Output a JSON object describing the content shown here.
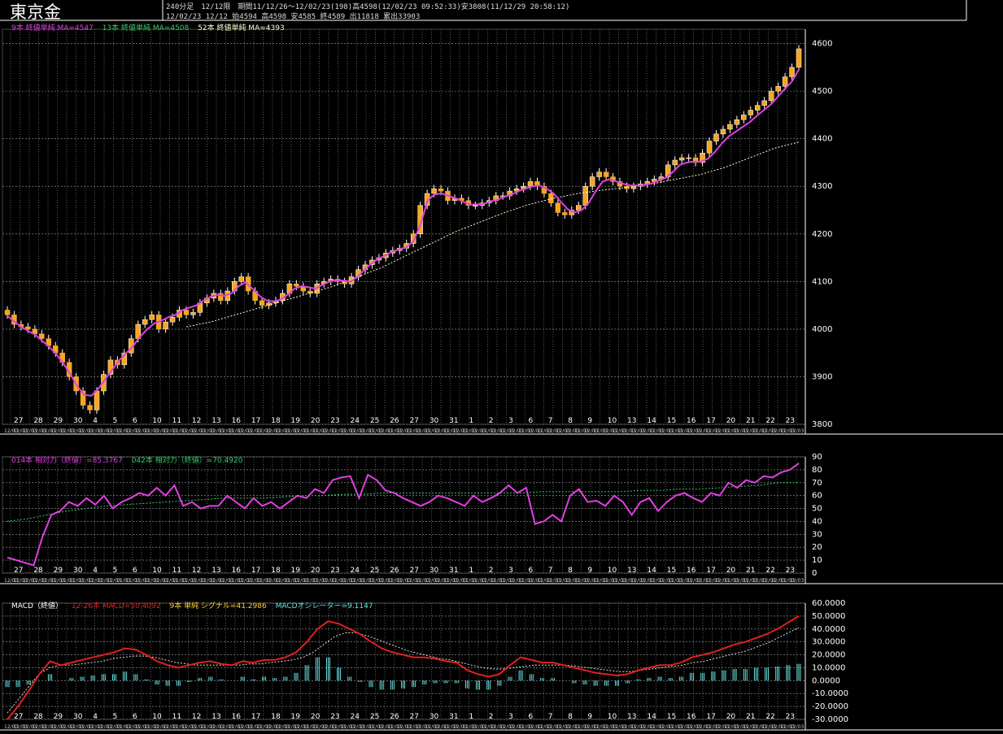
{
  "header": {
    "symbol": "東京金",
    "info_line1": "240分足　12/12限　期間11/12/26〜12/02/23(198)高4598(12/02/23 09:52:33)安3808(11/12/29 20:58:12)",
    "info_line2": "12/02/23 12/12 始4594 高4598 安4585 終4589 出11818 累出33903"
  },
  "colors": {
    "background": "#000000",
    "grid": "#c8c8c8",
    "candle_up": "#ffffff",
    "candle_down": "#f5a623",
    "ma9": "#e040e0",
    "ma13": "#33cc66",
    "ma52": "#ffffcc",
    "rsi14": "#e040e0",
    "rsi42": "#33cc66",
    "macd": "#e02020",
    "signal": "#dddddd",
    "oscillator": "#66e0e0",
    "axis_text": "#ffffff"
  },
  "x_date_labels": [
    "27",
    "28",
    "29",
    "30",
    "4",
    "5",
    "6",
    "10",
    "11",
    "12",
    "13",
    "16",
    "17",
    "18",
    "19",
    "20",
    "23",
    "24",
    "25",
    "26",
    "27",
    "30",
    "31",
    "1",
    "2",
    "3",
    "6",
    "7",
    "8",
    "9",
    "10",
    "13",
    "14",
    "15",
    "16",
    "17",
    "20",
    "21",
    "22",
    "23"
  ],
  "x_month_labels": [
    "1",
    "1",
    "2"
  ],
  "chart_data": [
    {
      "type": "candlestick",
      "name": "price",
      "legend": [
        "9本 終値単純 MA=4547",
        "13本 終値単純 MA=4508",
        "52本 終値単純 MA=4393"
      ],
      "yticks": [
        3800,
        3900,
        4000,
        4100,
        4200,
        4300,
        4400,
        4500,
        4600
      ],
      "ylim": [
        3800,
        4630
      ],
      "x_dates": [
        "11/12/27",
        "11/12/28",
        "11/12/29",
        "11/12/30",
        "12/01/04",
        "12/01/05",
        "12/01/06",
        "12/01/10",
        "12/01/11",
        "12/01/12",
        "12/01/13",
        "12/01/16",
        "12/01/17",
        "12/01/18",
        "12/01/19",
        "12/01/20",
        "12/01/23",
        "12/01/24",
        "12/01/25",
        "12/01/26",
        "12/01/27",
        "12/01/30",
        "12/01/31",
        "12/02/01",
        "12/02/02",
        "12/02/03",
        "12/02/06",
        "12/02/07",
        "12/02/08",
        "12/02/09",
        "12/02/10",
        "12/02/13",
        "12/02/14",
        "12/02/15",
        "12/02/16",
        "12/02/17",
        "12/02/20",
        "12/02/21",
        "12/02/22",
        "12/02/23"
      ],
      "closes": [
        4030,
        4010,
        4005,
        4000,
        3990,
        3980,
        3965,
        3950,
        3930,
        3900,
        3870,
        3840,
        3830,
        3870,
        3905,
        3935,
        3925,
        3950,
        3980,
        4010,
        4020,
        4030,
        4000,
        4015,
        4025,
        4040,
        4030,
        4035,
        4055,
        4065,
        4075,
        4060,
        4080,
        4100,
        4110,
        4080,
        4060,
        4050,
        4055,
        4060,
        4075,
        4095,
        4090,
        4080,
        4075,
        4095,
        4100,
        4105,
        4100,
        4095,
        4110,
        4125,
        4135,
        4145,
        4150,
        4160,
        4165,
        4170,
        4180,
        4200,
        4260,
        4285,
        4295,
        4290,
        4270,
        4275,
        4270,
        4260,
        4260,
        4265,
        4270,
        4280,
        4280,
        4290,
        4295,
        4300,
        4310,
        4300,
        4285,
        4265,
        4245,
        4240,
        4250,
        4260,
        4300,
        4320,
        4330,
        4320,
        4310,
        4300,
        4295,
        4300,
        4305,
        4310,
        4315,
        4320,
        4345,
        4355,
        4360,
        4360,
        4350,
        4370,
        4395,
        4410,
        4420,
        4430,
        4440,
        4450,
        4460,
        4470,
        4480,
        4500,
        4510,
        4530,
        4550,
        4589
      ],
      "ma9": [
        4028,
        4016,
        4005,
        3996,
        3988,
        3975,
        3962,
        3947,
        3928,
        3905,
        3880,
        3862,
        3860,
        3875,
        3895,
        3915,
        3935,
        3950,
        3965,
        3985,
        4000,
        4012,
        4018,
        4025,
        4030,
        4040,
        4045,
        4050,
        4060,
        4068,
        4072,
        4070,
        4075,
        4090,
        4098,
        4085,
        4070,
        4060,
        4058,
        4062,
        4072,
        4085,
        4090,
        4088,
        4085,
        4093,
        4100,
        4103,
        4102,
        4100,
        4110,
        4125,
        4138,
        4148,
        4155,
        4163,
        4168,
        4172,
        4185,
        4220,
        4270,
        4283,
        4285,
        4280,
        4275,
        4268,
        4262,
        4262,
        4263,
        4268,
        4272,
        4278,
        4283,
        4290,
        4295,
        4300,
        4302,
        4295,
        4285,
        4268,
        4252,
        4245,
        4250,
        4265,
        4290,
        4310,
        4315,
        4310,
        4305,
        4302,
        4302,
        4303,
        4306,
        4312,
        4318,
        4330,
        4345,
        4350,
        4352,
        4352,
        4358,
        4372,
        4390,
        4405,
        4415,
        4425,
        4435,
        4448,
        4460,
        4472,
        4488,
        4505,
        4520,
        4545
      ],
      "ma13_label": "13本 終値単純 MA=4508",
      "ma52_label": "52本 終値単純 MA=4393",
      "ma52": [
        4005,
        4015,
        4030,
        4045,
        4060,
        4075,
        4090,
        4110,
        4130,
        4155,
        4180,
        4205,
        4225,
        4245,
        4262,
        4275,
        4285,
        4292,
        4298,
        4305,
        4315,
        4325,
        4340,
        4360,
        4380,
        4393
      ]
    },
    {
      "type": "line",
      "name": "rsi",
      "legend": [
        "014本 相対力（終値）=85.3767",
        "042本 相対力（終値）=70.4920"
      ],
      "yticks": [
        0,
        10,
        20,
        30,
        40,
        50,
        60,
        70,
        80,
        90
      ],
      "ylim": [
        0,
        90
      ],
      "rsi14": [
        12,
        10,
        8,
        6,
        28,
        45,
        48,
        55,
        52,
        58,
        53,
        60,
        50,
        55,
        58,
        62,
        60,
        66,
        60,
        68,
        52,
        55,
        50,
        52,
        52,
        60,
        55,
        50,
        58,
        52,
        55,
        50,
        55,
        60,
        58,
        65,
        62,
        72,
        74,
        75,
        58,
        76,
        72,
        64,
        62,
        58,
        55,
        52,
        55,
        60,
        58,
        55,
        52,
        60,
        55,
        58,
        62,
        68,
        62,
        66,
        38,
        40,
        45,
        40,
        60,
        65,
        55,
        56,
        52,
        60,
        55,
        45,
        55,
        58,
        48,
        55,
        60,
        62,
        58,
        55,
        62,
        60,
        70,
        66,
        72,
        70,
        75,
        74,
        78,
        80,
        85
      ],
      "rsi42": [
        40,
        42,
        45,
        48,
        50,
        52,
        53,
        54,
        55,
        56,
        57,
        58,
        58,
        58,
        59,
        60,
        60,
        61,
        61,
        62,
        62,
        62,
        62,
        62,
        62,
        62,
        62,
        63,
        63,
        63,
        63,
        63,
        64,
        64,
        65,
        65,
        66,
        67,
        68,
        70,
        70
      ]
    },
    {
      "type": "line",
      "name": "macd",
      "legend": [
        "MACD（終値）",
        "12-26本 MACD=50.4092",
        "9本 単純 シグナル=41.2986",
        "MACDオシレーター=9.1147"
      ],
      "yticks": [
        "60.0000",
        "50.0000",
        "40.0000",
        "30.0000",
        "20.0000",
        "10.0000",
        "0.0000",
        "-10.0000",
        "-20.0000",
        "-30.0000"
      ],
      "ylim": [
        -30,
        60
      ],
      "macd": [
        -30,
        -20,
        -8,
        5,
        15,
        12,
        14,
        16,
        18,
        20,
        22,
        25,
        24,
        20,
        15,
        12,
        10,
        12,
        14,
        15,
        13,
        12,
        15,
        14,
        16,
        16,
        18,
        22,
        30,
        40,
        46,
        44,
        40,
        36,
        30,
        25,
        22,
        20,
        18,
        18,
        17,
        15,
        14,
        8,
        5,
        3,
        5,
        12,
        18,
        16,
        14,
        14,
        12,
        10,
        8,
        6,
        5,
        4,
        5,
        8,
        10,
        12,
        12,
        14,
        18,
        20,
        22,
        25,
        28,
        30,
        33,
        36,
        40,
        45,
        50
      ],
      "signal": [
        -25,
        -15,
        -5,
        5,
        10,
        12,
        12,
        13,
        14,
        15,
        17,
        18,
        19,
        19,
        18,
        16,
        14,
        13,
        12,
        12,
        12,
        12,
        12,
        13,
        13,
        14,
        15,
        16,
        18,
        22,
        28,
        34,
        37,
        37,
        35,
        32,
        29,
        26,
        23,
        21,
        19,
        17,
        16,
        14,
        12,
        10,
        9,
        9,
        10,
        11,
        12,
        12,
        12,
        12,
        11,
        10,
        9,
        8,
        7,
        7,
        8,
        9,
        10,
        11,
        12,
        14,
        15,
        17,
        19,
        21,
        23,
        26,
        29,
        33,
        37,
        41
      ],
      "oscillator": [
        -5,
        -5,
        -3,
        0,
        5,
        0,
        2,
        3,
        4,
        5,
        5,
        7,
        5,
        1,
        -3,
        -4,
        -4,
        -1,
        2,
        3,
        1,
        0,
        3,
        1,
        3,
        2,
        3,
        6,
        12,
        18,
        18,
        10,
        3,
        -1,
        -5,
        -7,
        -7,
        -6,
        -5,
        -3,
        -2,
        -2,
        -2,
        -6,
        -7,
        -7,
        -4,
        3,
        8,
        5,
        2,
        2,
        0,
        -2,
        -3,
        -4,
        -4,
        -4,
        -2,
        1,
        2,
        3,
        2,
        3,
        6,
        6,
        7,
        8,
        9,
        9,
        10,
        10,
        11,
        12,
        13
      ]
    }
  ]
}
